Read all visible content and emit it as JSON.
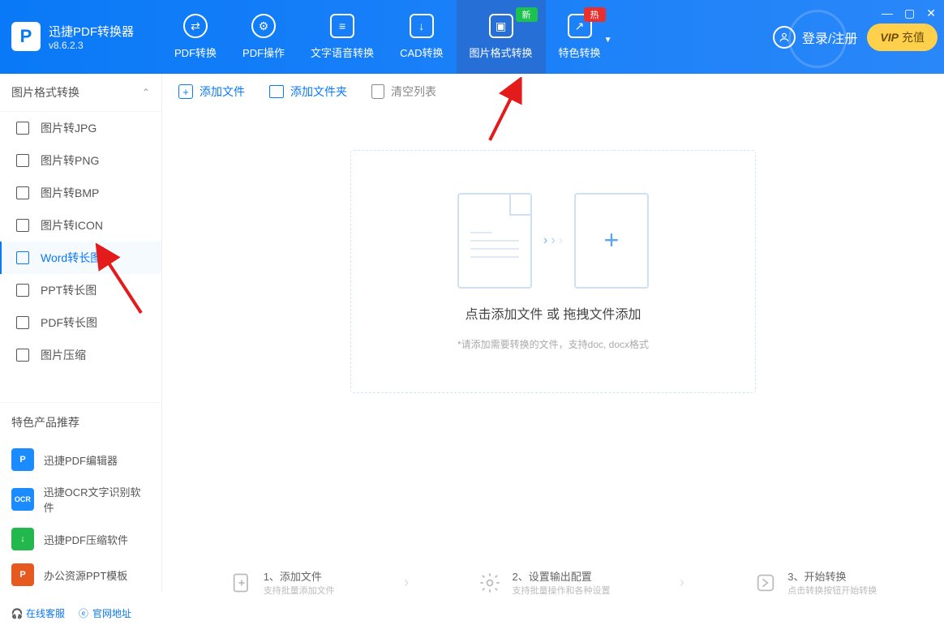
{
  "app": {
    "title": "迅捷PDF转换器",
    "version": "v8.6.2.3"
  },
  "nav": {
    "tabs": [
      {
        "label": "PDF转换"
      },
      {
        "label": "PDF操作"
      },
      {
        "label": "文字语音转换"
      },
      {
        "label": "CAD转换"
      },
      {
        "label": "图片格式转换",
        "badge": "新",
        "badge_color": "green",
        "active": true
      },
      {
        "label": "特色转换",
        "badge": "热",
        "badge_color": "red"
      }
    ]
  },
  "header_right": {
    "login": "登录/注册",
    "vip": "充值",
    "vip_prefix": "VIP"
  },
  "sidebar": {
    "header": "图片格式转换",
    "items": [
      {
        "label": "图片转JPG"
      },
      {
        "label": "图片转PNG"
      },
      {
        "label": "图片转BMP"
      },
      {
        "label": "图片转ICON"
      },
      {
        "label": "Word转长图",
        "selected": true
      },
      {
        "label": "PPT转长图"
      },
      {
        "label": "PDF转长图"
      },
      {
        "label": "图片压缩"
      }
    ],
    "recommend_header": "特色产品推荐",
    "recommends": [
      {
        "label": "迅捷PDF编辑器",
        "color": "#1a8cff",
        "badge": "P"
      },
      {
        "label": "迅捷OCR文字识别软件",
        "color": "#1a8cff",
        "badge": "OCR"
      },
      {
        "label": "迅捷PDF压缩软件",
        "color": "#22b84e",
        "badge": "↓"
      },
      {
        "label": "办公资源PPT模板",
        "color": "#e65a1f",
        "badge": "P"
      }
    ]
  },
  "toolbar": {
    "add_file": "添加文件",
    "add_folder": "添加文件夹",
    "clear_list": "清空列表"
  },
  "dropzone": {
    "title": "点击添加文件 或 拖拽文件添加",
    "hint": "*请添加需要转换的文件，支持doc, docx格式"
  },
  "steps": [
    {
      "title": "1、添加文件",
      "sub": "支持批量添加文件"
    },
    {
      "title": "2、设置输出配置",
      "sub": "支持批量操作和各种设置"
    },
    {
      "title": "3、开始转换",
      "sub": "点击转换按钮开始转换"
    }
  ],
  "footer": {
    "customer_service": "在线客服",
    "official_site": "官网地址"
  },
  "colors": {
    "primary": "#0a79f7",
    "accent": "#ffd04b"
  }
}
